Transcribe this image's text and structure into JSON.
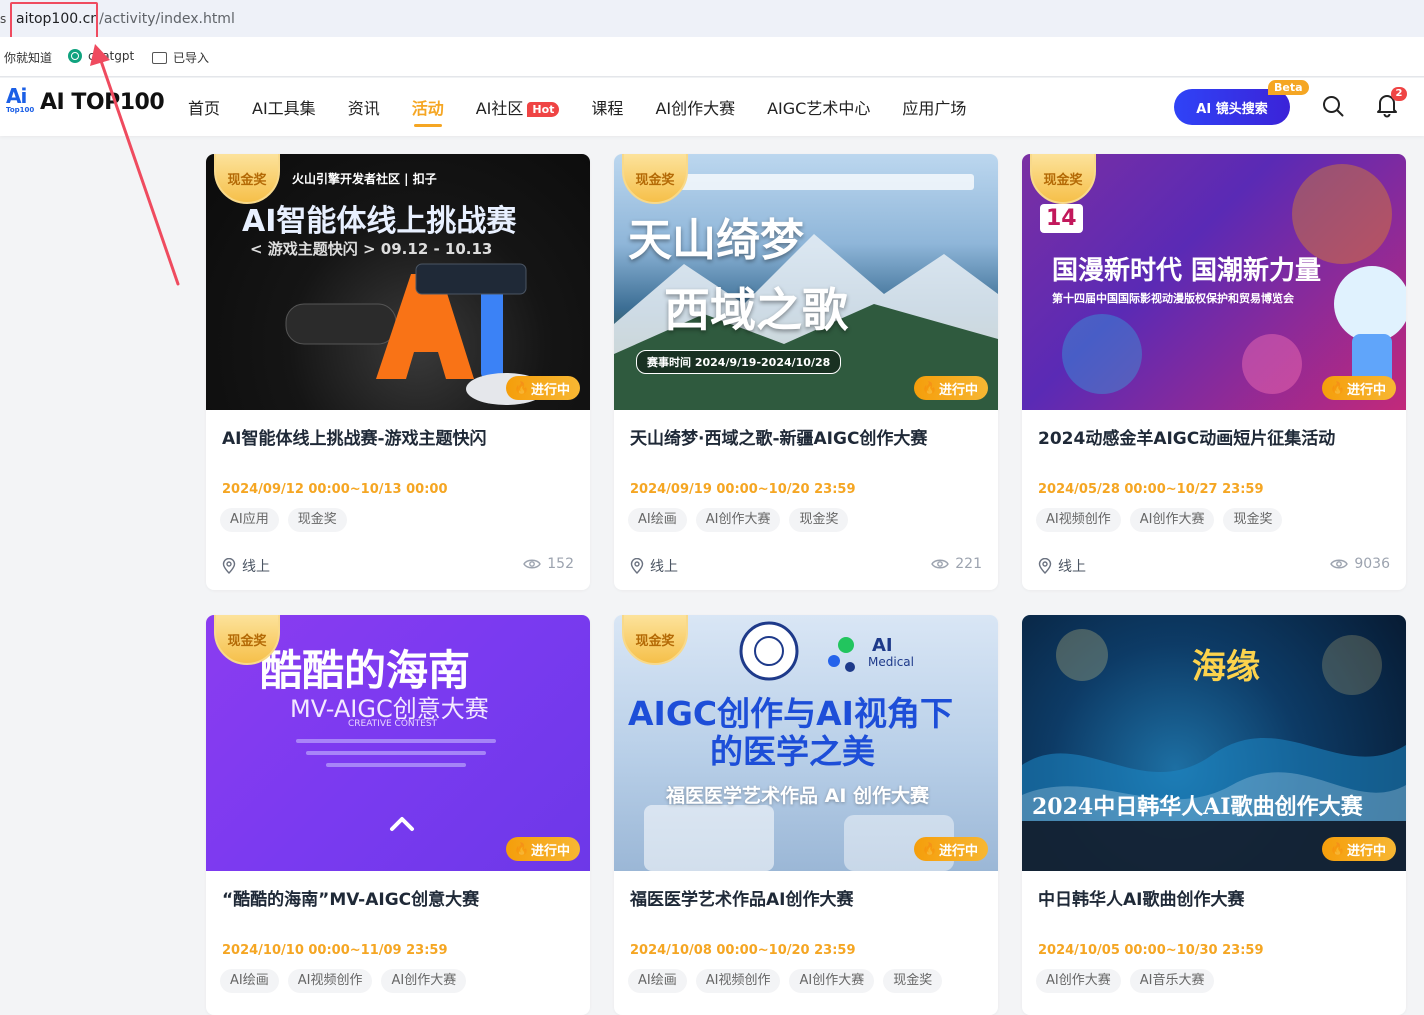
{
  "browser": {
    "url_prefix_mark": "s",
    "url_host": "aitop100.cn",
    "url_path": "/activity/index.html",
    "bookmarks": [
      {
        "label": "你就知道",
        "icon": "none"
      },
      {
        "label": "chatgpt",
        "icon": "openai-icon"
      },
      {
        "label": "已导入",
        "icon": "folder-icon"
      }
    ]
  },
  "header": {
    "logo_mark": "Ai",
    "logo_mark_sub": "Top100",
    "logo_text": "AI TOP100",
    "nav": [
      {
        "label": "首页"
      },
      {
        "label": "AI工具集"
      },
      {
        "label": "资讯"
      },
      {
        "label": "活动",
        "active": true
      },
      {
        "label": "AI社区",
        "badge": "Hot"
      },
      {
        "label": "课程"
      },
      {
        "label": "AI创作大赛"
      },
      {
        "label": "AIGC艺术中心"
      },
      {
        "label": "应用广场"
      }
    ],
    "search_button": "AI 镜头搜索",
    "search_badge": "Beta",
    "notification_count": "2"
  },
  "cards": [
    {
      "badge": "现金奖",
      "status": "进行中",
      "title": "AI智能体线上挑战赛-游戏主题快闪",
      "date": "2024/09/12 00:00~10/13 00:00",
      "tags": [
        "AI应用",
        "现金奖"
      ],
      "location": "线上",
      "views": "152",
      "banner": {
        "line1": "火山引擎开发者社区 | 扣子",
        "line2": "AI智能体线上挑战赛",
        "line3": "< 游戏主题快闪 >  09.12 - 10.13"
      }
    },
    {
      "badge": "现金奖",
      "status": "进行中",
      "title": "天山绮梦·西域之歌-新疆AIGC创作大赛",
      "date": "2024/09/19 00:00~10/20 23:59",
      "tags": [
        "AI绘画",
        "AI创作大赛",
        "现金奖"
      ],
      "location": "线上",
      "views": "221",
      "banner": {
        "line1": "天山绮梦",
        "line2": "西域之歌",
        "line3": "赛事时间  2024/9/19-2024/10/28"
      }
    },
    {
      "badge": "现金奖",
      "status": "进行中",
      "title": "2024动感金羊AIGC动画短片征集活动",
      "date": "2024/05/28 00:00~10/27 23:59",
      "tags": [
        "AI视频创作",
        "AI创作大赛",
        "现金奖"
      ],
      "location": "线上",
      "views": "9036",
      "banner": {
        "line1": "14",
        "line2": "国漫新时代 国潮新力量",
        "line3": "第十四届中国国际影视动漫版权保护和贸易博览会"
      }
    },
    {
      "badge": "现金奖",
      "status": "进行中",
      "title": "“酷酷的海南”MV-AIGC创意大赛",
      "date": "2024/10/10 00:00~11/09 23:59",
      "tags": [
        "AI绘画",
        "AI视频创作",
        "AI创作大赛"
      ],
      "location": "",
      "views": "",
      "banner": {
        "line1": "酷酷的海南",
        "line2": "MV-AIGC创意大赛",
        "line3": "CREATIVE CONTEST"
      }
    },
    {
      "badge": "现金奖",
      "status": "进行中",
      "title": "福医医学艺术作品AI创作大赛",
      "date": "2024/10/08 00:00~10/20 23:59",
      "tags": [
        "AI绘画",
        "AI视频创作",
        "AI创作大赛",
        "现金奖"
      ],
      "location": "",
      "views": "",
      "banner": {
        "line1": "AIGC创作与AI视角下",
        "line2": "的医学之美",
        "line3": "福医医学艺术作品 AI 创作大赛"
      }
    },
    {
      "badge": "",
      "status": "进行中",
      "title": "中日韩华人AI歌曲创作大赛",
      "date": "2024/10/05 00:00~10/30 23:59",
      "tags": [
        "AI创作大赛",
        "AI音乐大赛"
      ],
      "location": "",
      "views": "",
      "banner": {
        "line1": "海缘",
        "line2": "2024中日韩华人AI歌曲创作大赛",
        "line3": ""
      }
    }
  ],
  "colors": {
    "accent": "#f5a623",
    "brand_blue": "#2f43f7",
    "annotation_red": "#ef4b5f"
  }
}
